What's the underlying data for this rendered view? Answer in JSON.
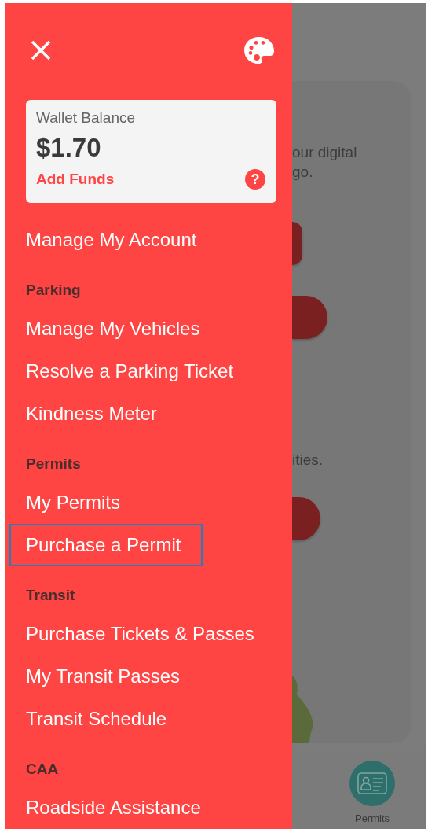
{
  "wallet": {
    "label": "Wallet Balance",
    "amount": "$1.70",
    "action": "Add Funds",
    "help": "?"
  },
  "menu": [
    {
      "kind": "item",
      "label": "Manage My Account",
      "selected": false
    },
    {
      "kind": "section",
      "label": "Parking"
    },
    {
      "kind": "item",
      "label": "Manage My Vehicles",
      "selected": false
    },
    {
      "kind": "item",
      "label": "Resolve a Parking Ticket",
      "selected": false
    },
    {
      "kind": "item",
      "label": "Kindness Meter",
      "selected": false
    },
    {
      "kind": "section",
      "label": "Permits"
    },
    {
      "kind": "item",
      "label": "My Permits",
      "selected": false
    },
    {
      "kind": "item",
      "label": "Purchase a Permit",
      "selected": true
    },
    {
      "kind": "section",
      "label": "Transit"
    },
    {
      "kind": "item",
      "label": "Purchase Tickets & Passes",
      "selected": false
    },
    {
      "kind": "item",
      "label": "My Transit Passes",
      "selected": false
    },
    {
      "kind": "item",
      "label": "Transit Schedule",
      "selected": false
    },
    {
      "kind": "section",
      "label": "CAA"
    },
    {
      "kind": "item",
      "label": "Roadside Assistance",
      "selected": false
    }
  ],
  "background_page": {
    "intro_lines": [
      "our digital",
      "go."
    ],
    "section_text": "ities.",
    "tab_bar": [
      {
        "label": "Permits",
        "selected": true
      }
    ]
  }
}
